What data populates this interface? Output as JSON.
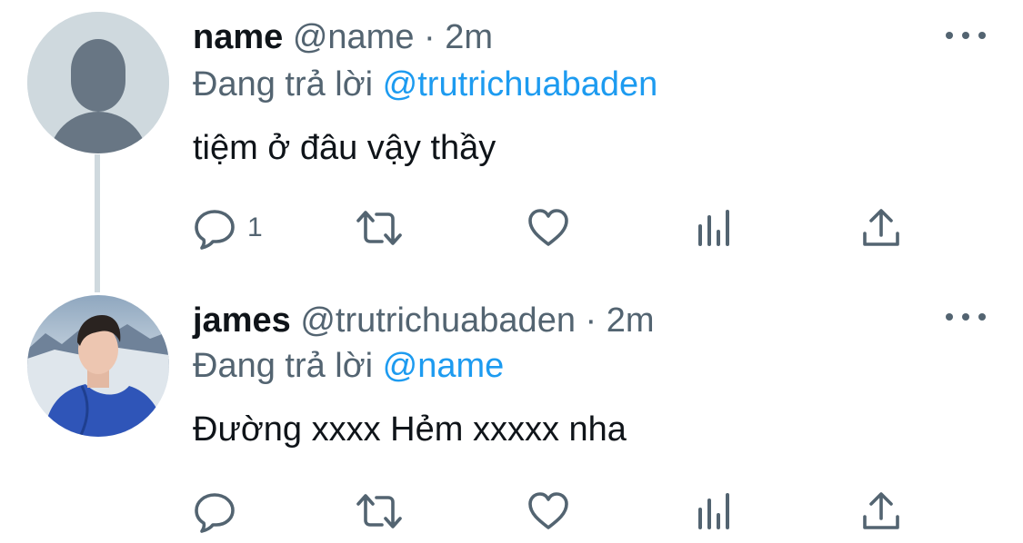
{
  "tweets": [
    {
      "name": "name",
      "handle": "@name",
      "separator": "·",
      "time": "2m",
      "replying_prefix": "Đang trả lời",
      "replying_to": "@trutrichuabaden",
      "text": "tiệm ở đâu vậy thầy",
      "reply_count": "1",
      "avatar": "default-profile-placeholder"
    },
    {
      "name": "james",
      "handle": "@trutrichuabaden",
      "separator": "·",
      "time": "2m",
      "replying_prefix": "Đang trả lời",
      "replying_to": "@name",
      "text": "Đường xxxx Hẻm xxxxx nha",
      "reply_count": "",
      "avatar": "user-photo"
    }
  ],
  "icons": {
    "reply": "speech-bubble-icon",
    "retweet": "retweet-arrows-icon",
    "like": "heart-icon",
    "views": "bar-chart-icon",
    "share": "share-upload-icon",
    "more": "ellipsis-icon"
  },
  "colors": {
    "text": "#0f1419",
    "secondary": "#536471",
    "link": "#1d9bf0",
    "thread_line": "#cfd9de",
    "placeholder_avatar_bg": "#cfd9de",
    "placeholder_avatar_fg": "#687684"
  }
}
